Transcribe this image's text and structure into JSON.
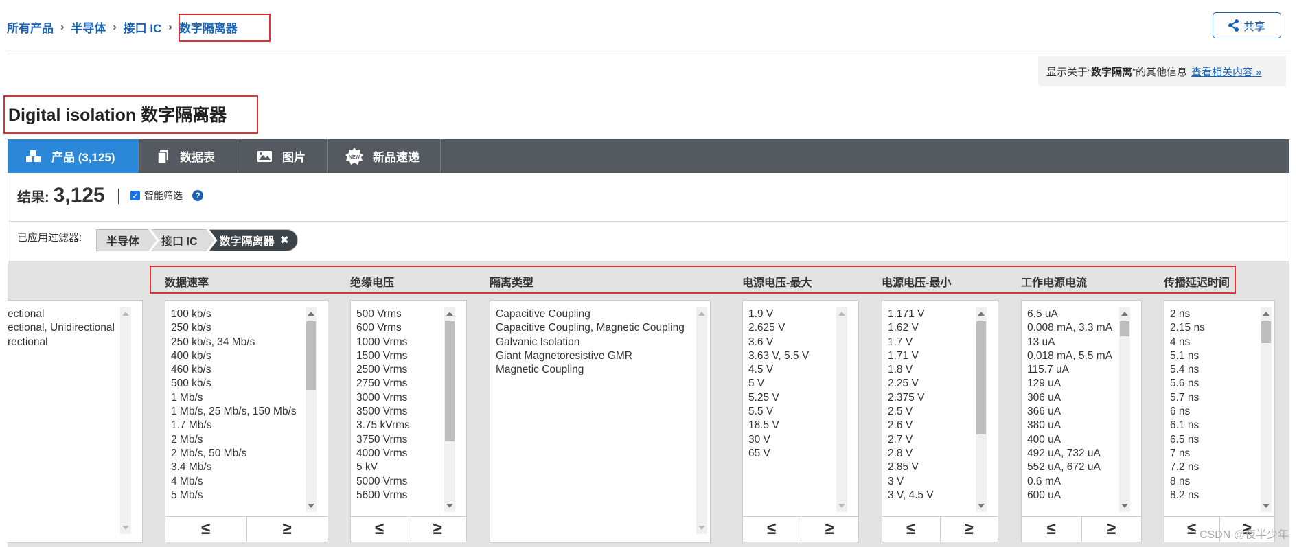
{
  "breadcrumb": {
    "items": [
      "所有产品",
      "半导体",
      "接口 IC"
    ],
    "current": "数字隔离器"
  },
  "share": {
    "label": "共享"
  },
  "related": {
    "prefix": "显示关于“",
    "term": "数字隔离",
    "suffix": "”的其他信息",
    "link": "查看相关内容 »"
  },
  "page_title": "Digital isolation 数字隔离器",
  "tabs": [
    {
      "label": "产品 (3,125)",
      "icon": "cubes-icon"
    },
    {
      "label": "数据表",
      "icon": "documents-icon"
    },
    {
      "label": "图片",
      "icon": "image-icon"
    },
    {
      "label": "新品速递",
      "icon": "new-badge-icon"
    }
  ],
  "results": {
    "label": "结果:",
    "count": "3,125",
    "smart_filter_label": "智能筛选",
    "help": "?"
  },
  "applied_filters": {
    "label": "已应用过滤器:",
    "chips": [
      "半导体",
      "接口 IC",
      "数字隔离器"
    ],
    "remove": "✖"
  },
  "filters": {
    "direction": {
      "header": "",
      "options": [
        "ectional",
        "ectional, Unidirectional",
        "rectional"
      ]
    },
    "data_rate": {
      "header": "数据速率",
      "options": [
        "100 kb/s",
        "250 kb/s",
        "250 kb/s, 34 Mb/s",
        "400 kb/s",
        "460 kb/s",
        "500 kb/s",
        "1 Mb/s",
        "1 Mb/s, 25 Mb/s, 150 Mb/s",
        "1.7 Mb/s",
        "2 Mb/s",
        "2 Mb/s, 50 Mb/s",
        "3.4 Mb/s",
        "4 Mb/s",
        "5 Mb/s"
      ]
    },
    "isolation_voltage": {
      "header": "绝缘电压",
      "options": [
        "500 Vrms",
        "600 Vrms",
        "1000 Vrms",
        "1500 Vrms",
        "2500 Vrms",
        "2750 Vrms",
        "3000 Vrms",
        "3500 Vrms",
        "3.75 kVrms",
        "3750 Vrms",
        "4000 Vrms",
        "5 kV",
        "5000 Vrms",
        "5600 Vrms"
      ]
    },
    "isolation_type": {
      "header": "隔离类型",
      "options": [
        "Capacitive Coupling",
        "Capacitive Coupling, Magnetic Coupling",
        "Galvanic Isolation",
        "Giant Magnetoresistive GMR",
        "Magnetic Coupling"
      ]
    },
    "supply_voltage_max": {
      "header": "电源电压-最大",
      "options": [
        "1.9 V",
        "2.625 V",
        "3.6 V",
        "3.63 V, 5.5 V",
        "4.5 V",
        "5 V",
        "5.25 V",
        "5.5 V",
        "18.5 V",
        "30 V",
        "65 V"
      ]
    },
    "supply_voltage_min": {
      "header": "电源电压-最小",
      "options": [
        "1.171 V",
        "1.62 V",
        "1.7 V",
        "1.71 V",
        "1.8 V",
        "2.25 V",
        "2.375 V",
        "2.5 V",
        "2.6 V",
        "2.7 V",
        "2.8 V",
        "2.85 V",
        "3 V",
        "3 V, 4.5 V"
      ]
    },
    "supply_current": {
      "header": "工作电源电流",
      "options": [
        "6.5 uA",
        "0.008 mA, 3.3 mA",
        "13 uA",
        "0.018 mA, 5.5 mA",
        "115.7 uA",
        "129 uA",
        "306 uA",
        "366 uA",
        "380 uA",
        "400 uA",
        "492 uA, 732 uA",
        "552 uA, 672 uA",
        "0.6 mA",
        "600 uA"
      ]
    },
    "prop_delay": {
      "header": "传播延迟时间",
      "options": [
        "2 ns",
        "2.15 ns",
        "4 ns",
        "5.1 ns",
        "5.4 ns",
        "5.6 ns",
        "5.7 ns",
        "6 ns",
        "6.1 ns",
        "6.5 ns",
        "7 ns",
        "7.2 ns",
        "8 ns",
        "8.2 ns"
      ]
    }
  },
  "range_buttons": {
    "lte": "≤",
    "gte": "≥"
  },
  "watermark": "CSDN @夜半少年",
  "colors": {
    "accent": "#1a63b4",
    "tab_active": "#2b87d8",
    "tab_bar": "#545a60",
    "highlight_box": "#e23232"
  }
}
